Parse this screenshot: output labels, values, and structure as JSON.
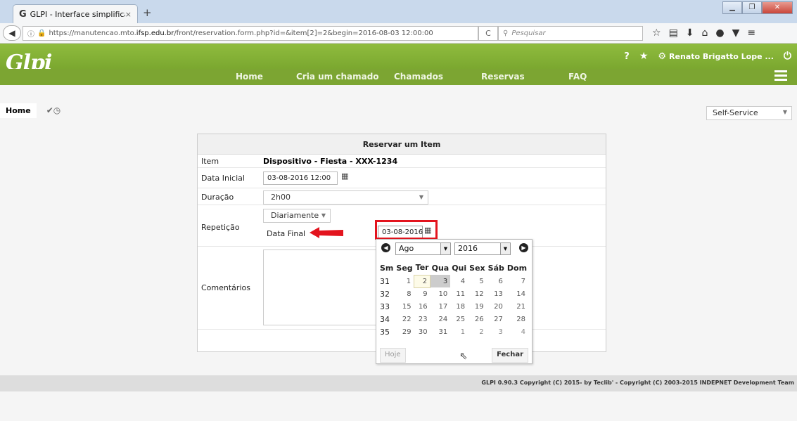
{
  "browser": {
    "tab_title": "GLPI - Interface simplificada",
    "tab_close": "×",
    "new_tab": "+",
    "url_prefix": "https://manutencao.mto.",
    "url_host": "ifsp.edu.br",
    "url_suffix": "/front/reservation.form.php?id=&item[2]=2&begin=2016-08-03 12:00:00",
    "search_placeholder": "Pesquisar"
  },
  "header": {
    "logo": "Glpi",
    "help": "?",
    "user": "Renato Brigatto Lope ...",
    "menu": [
      "Home",
      "Cria um chamado",
      "Chamados",
      "Reservas",
      "FAQ"
    ]
  },
  "breadcrumb": {
    "home": "Home"
  },
  "profile_select": "Self-Service",
  "form": {
    "title": "Reservar um Item",
    "item_label": "Item",
    "item_value": "Dispositivo - Fiesta - XXX-1234",
    "start_label": "Data Inicial",
    "start_value": "03-08-2016 12:00",
    "duration_label": "Duração",
    "duration_value": "2h00",
    "repeat_label": "Repetição",
    "repeat_value": "Diariamente",
    "end_label": "Data Final",
    "end_value": "03-08-2016",
    "comments_label": "Comentários"
  },
  "datepicker": {
    "month": "Ago",
    "year": "2016",
    "headers": [
      "Sm",
      "Seg",
      "Ter",
      "Qua",
      "Qui",
      "Sex",
      "Sáb",
      "Dom"
    ],
    "weeks": [
      {
        "wk": "31",
        "days": [
          "1",
          "2",
          "3",
          "4",
          "5",
          "6",
          "7"
        ]
      },
      {
        "wk": "32",
        "days": [
          "8",
          "9",
          "10",
          "11",
          "12",
          "13",
          "14"
        ]
      },
      {
        "wk": "33",
        "days": [
          "15",
          "16",
          "17",
          "18",
          "19",
          "20",
          "21"
        ]
      },
      {
        "wk": "34",
        "days": [
          "22",
          "23",
          "24",
          "25",
          "26",
          "27",
          "28"
        ]
      },
      {
        "wk": "35",
        "days": [
          "29",
          "30",
          "31",
          "1",
          "2",
          "3",
          "4"
        ]
      }
    ],
    "today_button": "Hoje",
    "close_button": "Fechar"
  },
  "footer": "GLPI 0.90.3 Copyright (C) 2015- by Teclib' - Copyright (C) 2003-2015 INDEPNET Development Team"
}
